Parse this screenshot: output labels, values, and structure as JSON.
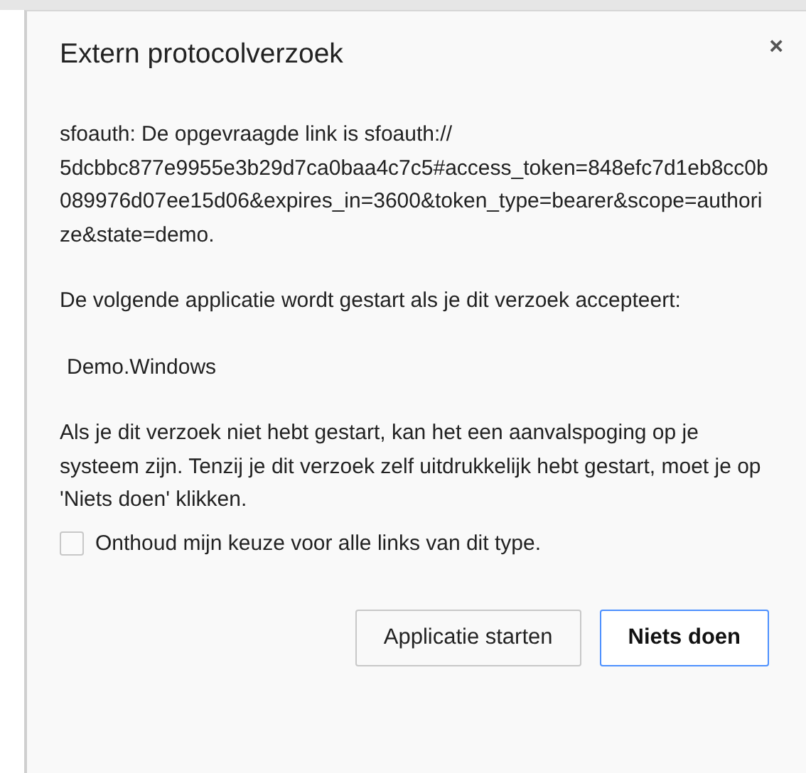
{
  "dialog": {
    "title": "Extern protocolverzoek",
    "close_label": "×",
    "paragraphs": [
      {
        "kind": "text",
        "text": "sfoauth: De opgevraagde link is sfoauth:// 5dcbbc877e9955e3b29d7ca0baa4c7c5#access_token=848efc7d1eb8cc0b089976d07ee15d06&expires_in=3600&token_type=bearer&scope=authorize&state=demo."
      },
      {
        "kind": "text",
        "text": "De volgende applicatie wordt gestart als je dit verzoek accepteert:"
      },
      {
        "kind": "app",
        "text": "Demo.Windows"
      },
      {
        "kind": "text",
        "text": "Als je dit verzoek niet hebt gestart, kan het een aanvalspoging op je systeem zijn. Tenzij je dit verzoek zelf uitdrukkelijk hebt gestart, moet je op 'Niets doen' klikken."
      }
    ],
    "checkbox": {
      "label": "Onthoud mijn keuze voor alle links van dit type.",
      "checked": false
    },
    "buttons": [
      {
        "label": "Applicatie starten",
        "default": false
      },
      {
        "label": "Niets doen",
        "default": true
      }
    ]
  }
}
